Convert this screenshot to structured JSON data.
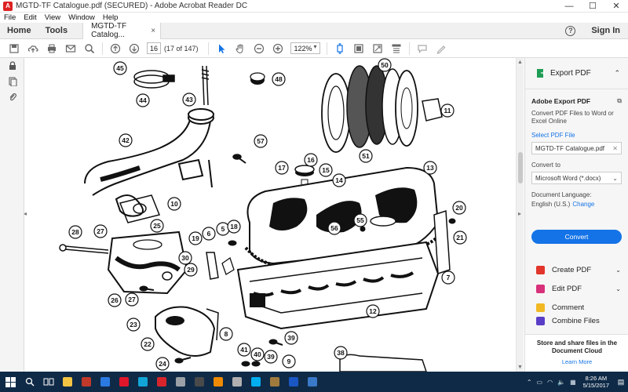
{
  "window": {
    "title": "MGTD-TF Catalogue.pdf (SECURED) - Adobe Acrobat Reader DC",
    "minimize": "—",
    "maximize": "☐",
    "close": "✕"
  },
  "menu": [
    "File",
    "Edit",
    "View",
    "Window",
    "Help"
  ],
  "tabs": {
    "home": "Home",
    "tools": "Tools",
    "document": "MGTD-TF Catalog...",
    "close": "×",
    "signin": "Sign In",
    "help": "?"
  },
  "toolbar": {
    "page_number": "16",
    "page_count": "(17 of 147)",
    "zoom": "122%"
  },
  "drawing": {
    "callouts": [
      "45",
      "44",
      "43",
      "48",
      "50",
      "11",
      "42",
      "57",
      "51",
      "17",
      "16",
      "15",
      "13",
      "14",
      "10",
      "28",
      "27",
      "25",
      "19",
      "6",
      "5",
      "18",
      "56",
      "55",
      "20",
      "21",
      "30",
      "29",
      "7",
      "26",
      "27",
      "12",
      "23",
      "22",
      "8",
      "39",
      "41",
      "40",
      "39",
      "9",
      "24",
      "38"
    ]
  },
  "export_panel": {
    "header": "Export PDF",
    "title": "Adobe Export PDF",
    "description": "Convert PDF Files to Word or Excel Online",
    "select_link": "Select PDF File",
    "file_name": "MGTD-TF Catalogue.pdf",
    "convert_to_label": "Convert to",
    "convert_to_value": "Microsoft Word (*.docx)",
    "language_label": "Document Language:",
    "language_value": "English (U.S.)",
    "change_link": "Change",
    "convert_button": "Convert"
  },
  "tools": [
    {
      "label": "Create PDF",
      "color": "#e2352b"
    },
    {
      "label": "Edit PDF",
      "color": "#d8307a"
    },
    {
      "label": "Comment",
      "color": "#f2b824"
    },
    {
      "label": "Combine Files",
      "color": "#5b3ec8"
    }
  ],
  "cloud": {
    "text": "Store and share files in the Document Cloud",
    "link": "Learn More"
  },
  "taskbar": {
    "apps": [
      {
        "name": "file-explorer",
        "color": "#f4c542"
      },
      {
        "name": "app-red",
        "color": "#c0392b"
      },
      {
        "name": "app-blue",
        "color": "#2a7ae2"
      },
      {
        "name": "app-opera",
        "color": "#e0162b"
      },
      {
        "name": "app-cyan",
        "color": "#12a5d8"
      },
      {
        "name": "app-flash",
        "color": "#d7252b"
      },
      {
        "name": "app-grey",
        "color": "#9aa0a6"
      },
      {
        "name": "app-dark",
        "color": "#4a4a4a"
      },
      {
        "name": "app-vlc",
        "color": "#f08a00"
      },
      {
        "name": "app-gray2",
        "color": "#b0b0b0"
      },
      {
        "name": "app-skype",
        "color": "#00aff0"
      },
      {
        "name": "app-tan",
        "color": "#a07a3c"
      },
      {
        "name": "app-m",
        "color": "#1a56c4"
      },
      {
        "name": "app-doc",
        "color": "#3a78c8"
      }
    ],
    "time": "8:26 AM",
    "date": "5/15/2017"
  }
}
